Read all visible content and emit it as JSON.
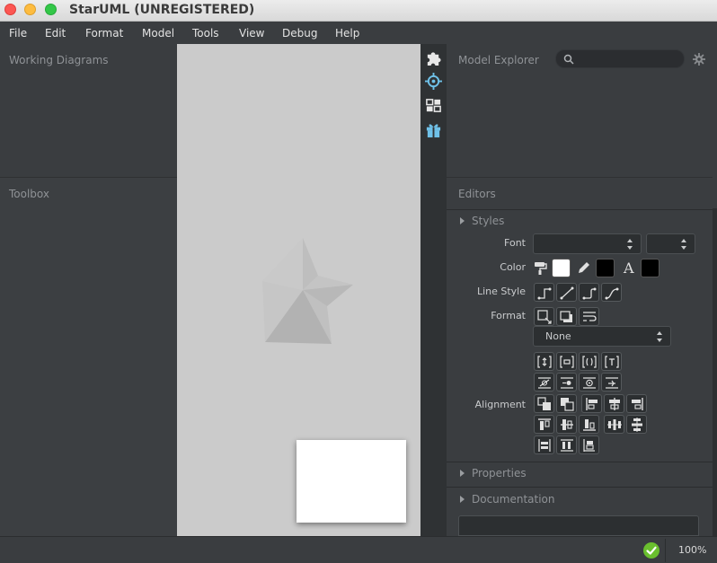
{
  "window": {
    "title": "StarUML (UNREGISTERED)"
  },
  "menu": [
    "File",
    "Edit",
    "Format",
    "Model",
    "Tools",
    "View",
    "Debug",
    "Help"
  ],
  "panels": {
    "working_diagrams": "Working Diagrams",
    "toolbox": "Toolbox",
    "model_explorer": "Model Explorer",
    "editors": "Editors"
  },
  "search": {
    "placeholder": ""
  },
  "sidebar_icons": [
    "extension-icon",
    "crosshair-icon",
    "layout-icon",
    "gift-icon"
  ],
  "editors": {
    "styles_header": "Styles",
    "font_label": "Font",
    "font_value": "",
    "font_size_value": "",
    "color_label": "Color",
    "line_style_label": "Line Style",
    "format_label": "Format",
    "format_select_value": "None",
    "alignment_label": "Alignment",
    "text_color_glyph": "A",
    "properties_header": "Properties",
    "documentation_header": "Documentation",
    "colors": {
      "fill": "#ffffff",
      "line": "#000000",
      "font": "#000000"
    }
  },
  "status": {
    "zoom": "100%"
  },
  "theme": {
    "accent": "#6fc1e8",
    "status_ok": "#6abf2e"
  }
}
